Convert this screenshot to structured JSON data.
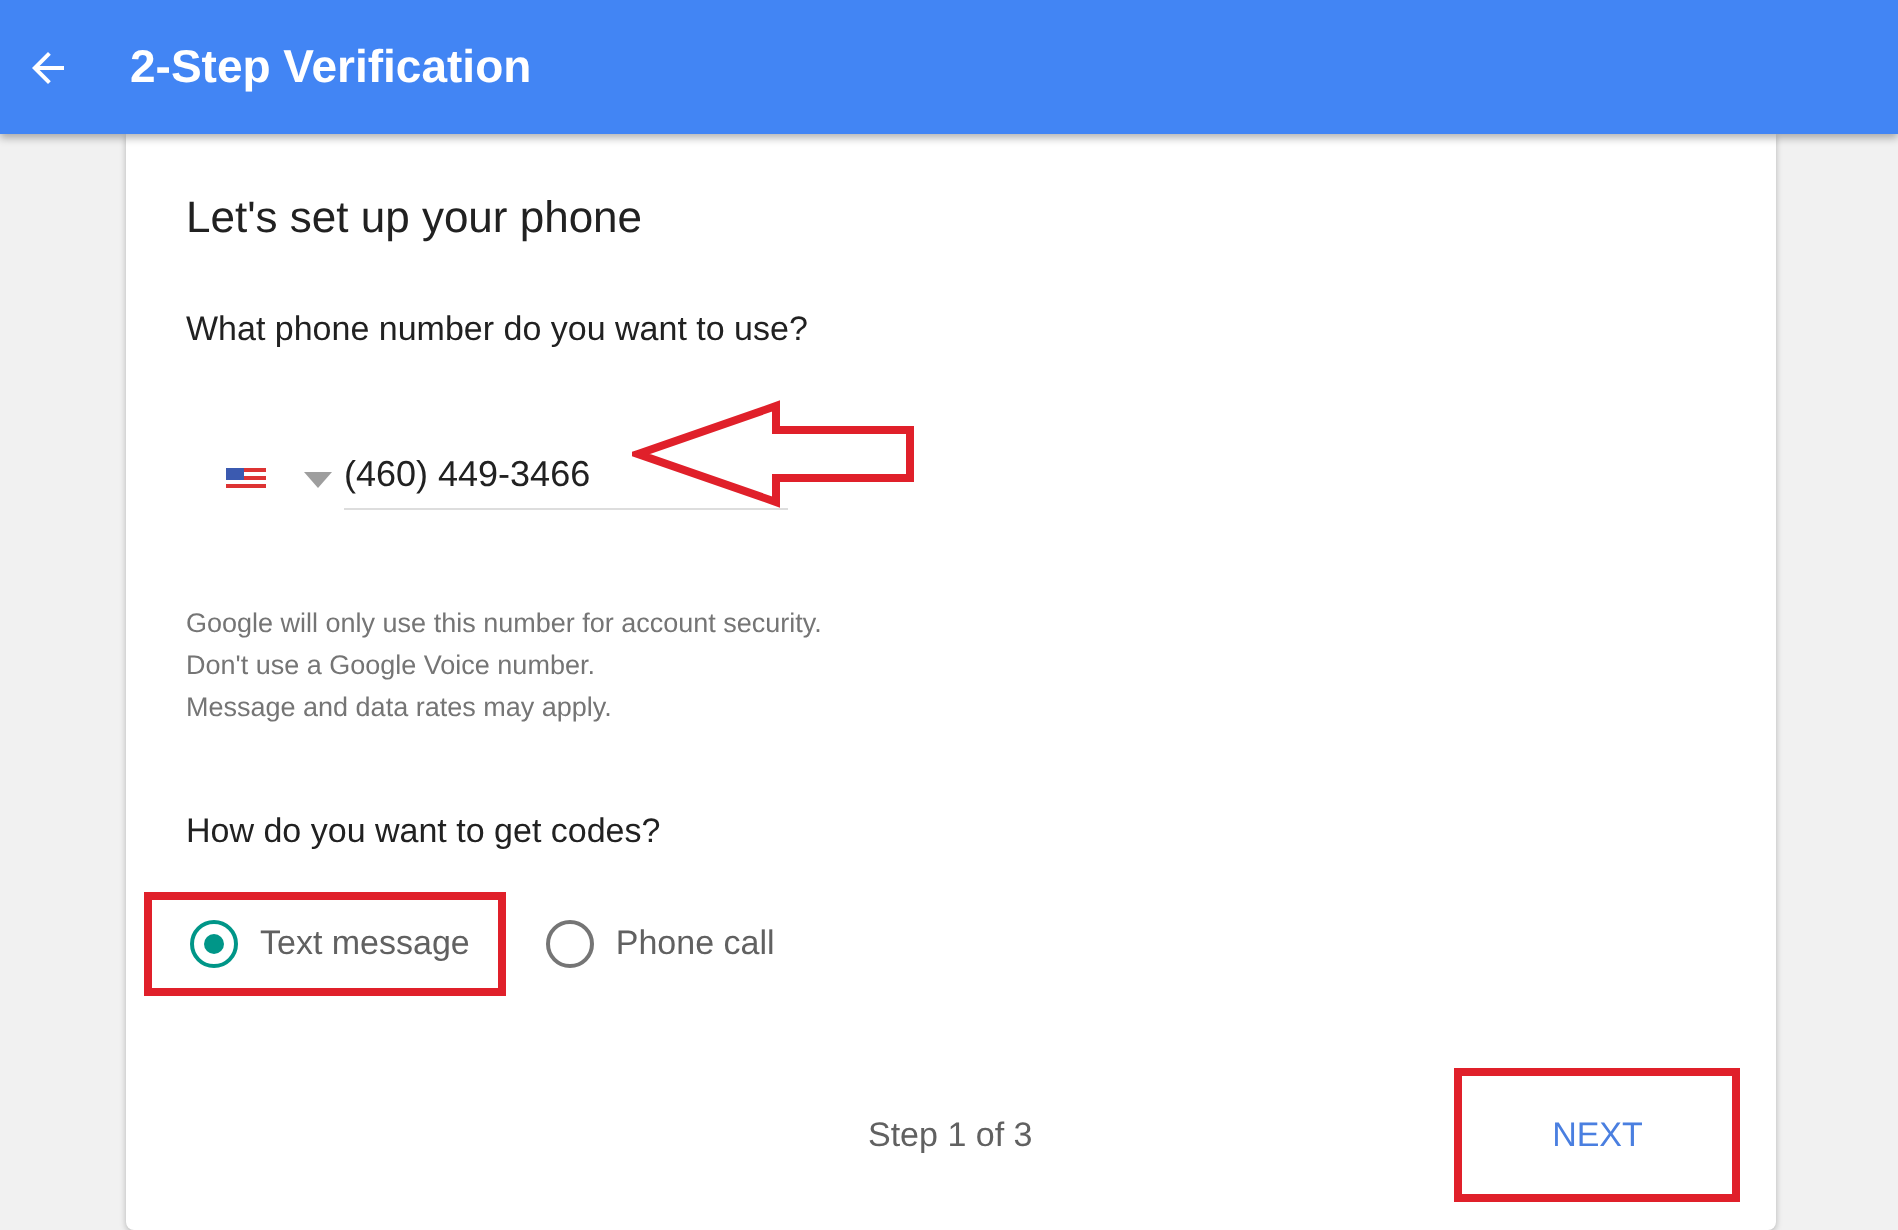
{
  "header": {
    "title": "2-Step Verification"
  },
  "card": {
    "title": "Let's set up your phone",
    "phone_question": "What phone number do you want to use?",
    "phone_field": {
      "value": "(460) 449-3466"
    },
    "notes": [
      "Google will only use this number for account security.",
      "Don't use a Google Voice number.",
      "Message and data rates may apply."
    ],
    "codes_question": "How do you want to get codes?",
    "options": [
      {
        "label": "Text message",
        "selected": true
      },
      {
        "label": "Phone call",
        "selected": false
      }
    ],
    "step": "Step 1 of 3",
    "next_button": "NEXT"
  }
}
